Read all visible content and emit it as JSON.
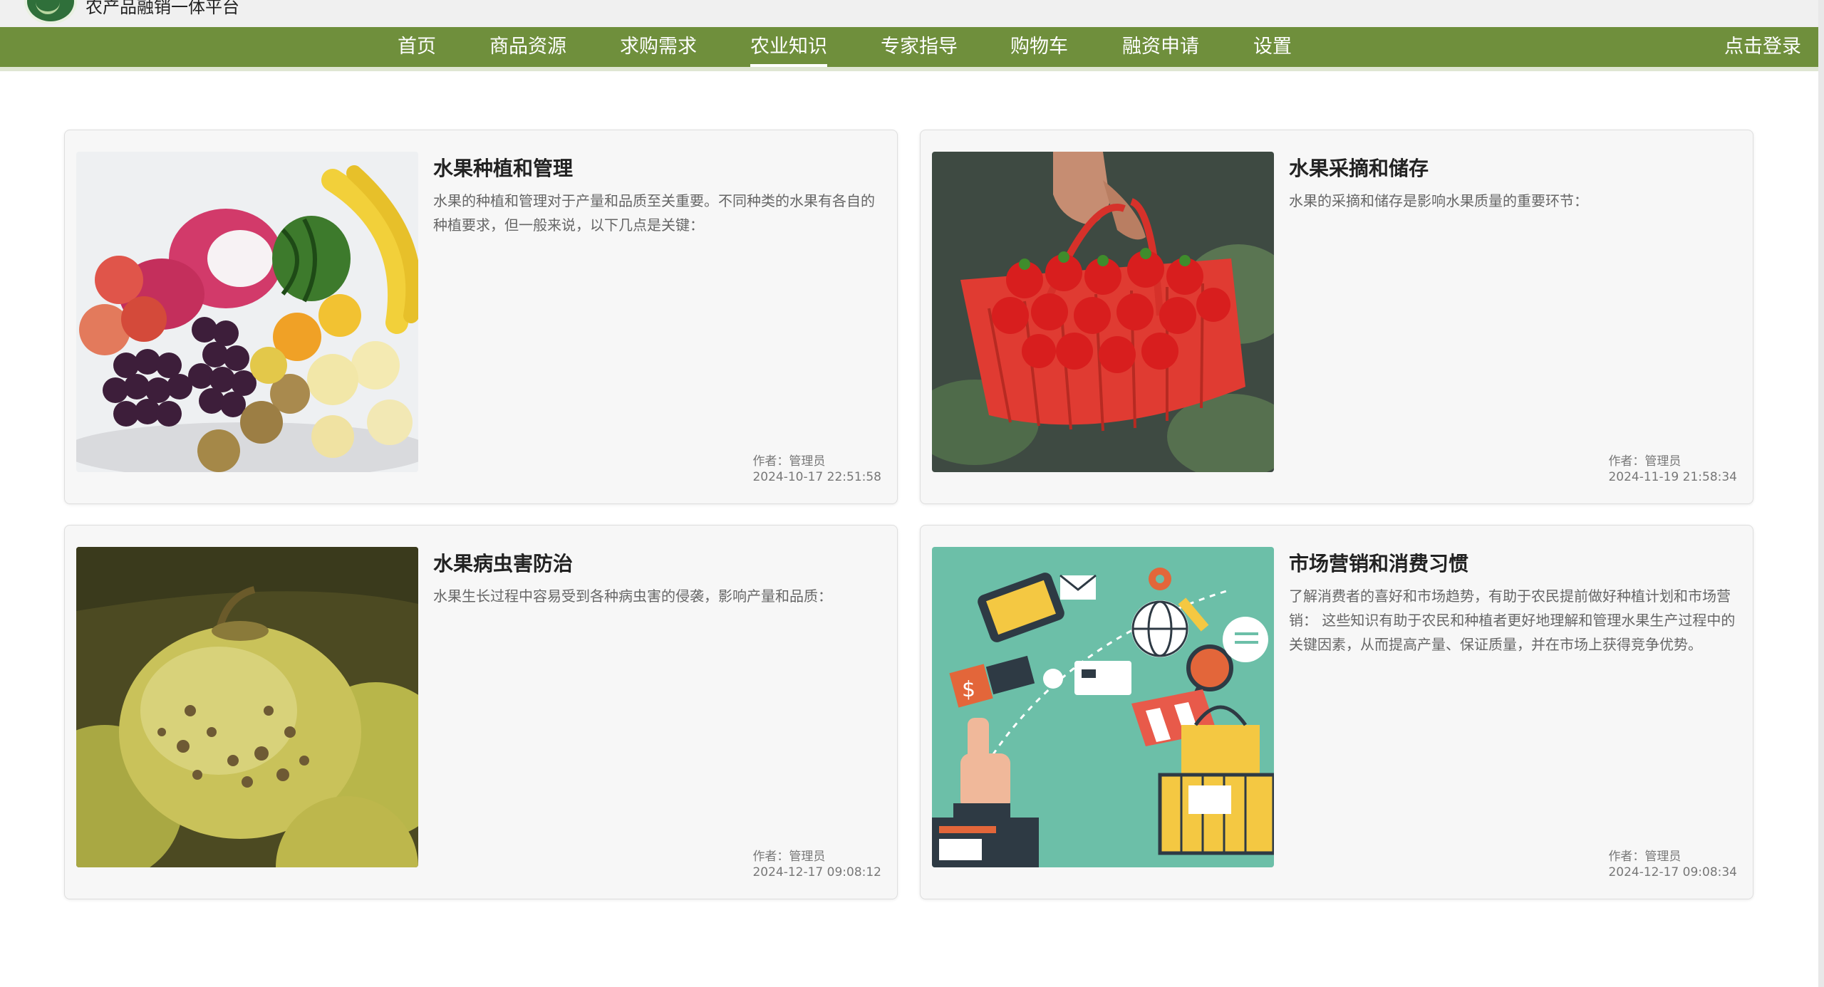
{
  "header": {
    "site_title": "农产品融销一体平台"
  },
  "nav": {
    "items": [
      {
        "label": "首页"
      },
      {
        "label": "商品资源"
      },
      {
        "label": "求购需求"
      },
      {
        "label": "农业知识",
        "active": true
      },
      {
        "label": "专家指导"
      },
      {
        "label": "购物车"
      },
      {
        "label": "融资申请"
      },
      {
        "label": "设置"
      }
    ],
    "login_label": "点击登录",
    "bar_color": "#6f8f3c"
  },
  "articles": [
    {
      "title": "水果种植和管理",
      "summary": "水果的种植和管理对于产量和品质至关重要。不同种类的水果有各自的种植要求，但一般来说，以下几点是关键：",
      "author_label": "作者：管理员",
      "date": "2024-10-17 22:51:58",
      "image_icon": "fruit-assortment-image"
    },
    {
      "title": "水果采摘和储存",
      "summary": "水果的采摘和储存是影响水果质量的重要环节：",
      "author_label": "作者：管理员",
      "date": "2024-11-19 21:58:34",
      "image_icon": "strawberry-basket-image"
    },
    {
      "title": "水果病虫害防治",
      "summary": "水果生长过程中容易受到各种病虫害的侵袭，影响产量和品质：",
      "author_label": "作者：管理员",
      "date": "2024-12-17 09:08:12",
      "image_icon": "diseased-fruit-image"
    },
    {
      "title": "市场营销和消费习惯",
      "summary": "了解消费者的喜好和市场趋势，有助于农民提前做好种植计划和市场营销： 这些知识有助于农民和种植者更好地理解和管理水果生产过程中的关键因素，从而提高产量、保证质量，并在市场上获得竞争优势。",
      "author_label": "作者：管理员",
      "date": "2024-12-17 09:08:34",
      "image_icon": "marketing-illustration-image"
    }
  ]
}
